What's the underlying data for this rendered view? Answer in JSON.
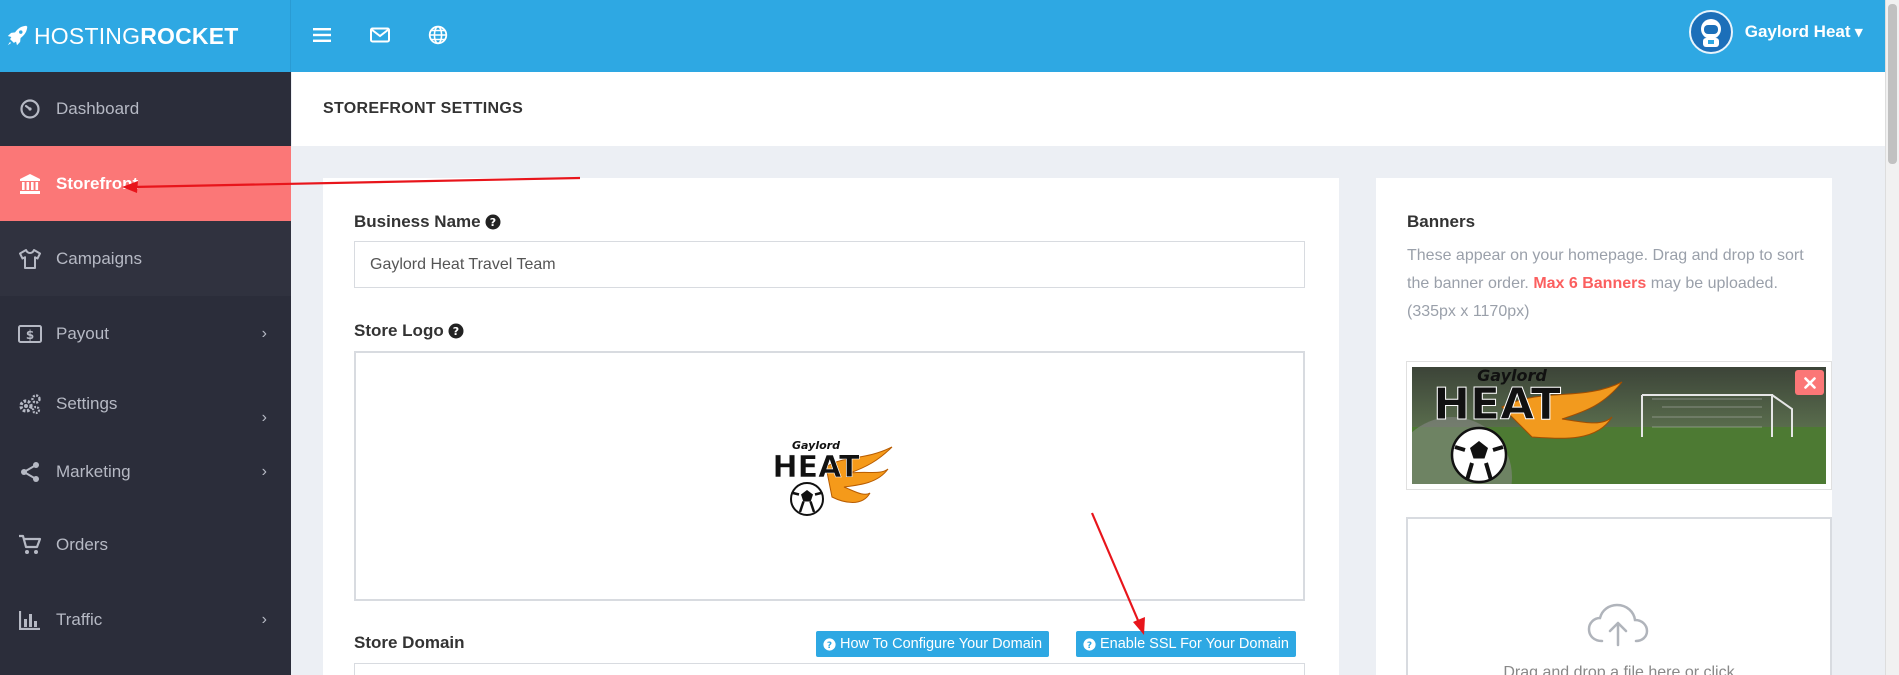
{
  "brand": {
    "light": "HOSTING",
    "bold": "ROCKET"
  },
  "user": {
    "name": "Gaylord Heat"
  },
  "topbar_icons": [
    "menu-icon",
    "mail-icon",
    "globe-icon"
  ],
  "sidebar": {
    "items": [
      {
        "label": "Dashboard",
        "icon": "dashboard-icon",
        "has_submenu": false
      },
      {
        "label": "Storefront",
        "icon": "bank-icon",
        "has_submenu": false,
        "active": true
      },
      {
        "label": "Campaigns",
        "icon": "shirt-icon",
        "has_submenu": false
      },
      {
        "label": "Payout",
        "icon": "dollar-icon",
        "has_submenu": true
      },
      {
        "label": "Settings",
        "icon": "gears-icon",
        "has_submenu": true
      },
      {
        "label": "Marketing",
        "icon": "share-icon",
        "has_submenu": true
      },
      {
        "label": "Orders",
        "icon": "cart-icon",
        "has_submenu": false
      },
      {
        "label": "Traffic",
        "icon": "bar-chart-icon",
        "has_submenu": true
      }
    ]
  },
  "page": {
    "title": "STOREFRONT SETTINGS"
  },
  "form": {
    "business_name_label": "Business Name",
    "business_name_value": "Gaylord Heat Travel Team",
    "store_logo_label": "Store Logo",
    "store_domain_label": "Store Domain",
    "configure_domain_button": "How To Configure Your Domain",
    "enable_ssl_button": "Enable SSL For Your Domain"
  },
  "logo": {
    "line1": "Gaylord",
    "line2": "HEAT"
  },
  "banners": {
    "title": "Banners",
    "desc_before": "These appear on your homepage. Drag and drop to sort the banner order. ",
    "desc_highlight": "Max 6 Banners",
    "desc_after": " may be uploaded. (335px x 1170px)",
    "dropzone_text": "Drag and drop a file here or click"
  },
  "colors": {
    "accent": "#2ea8e3",
    "active": "#fb7777",
    "sidebar": "#2b2d3a",
    "annotation": "#e8151b"
  }
}
